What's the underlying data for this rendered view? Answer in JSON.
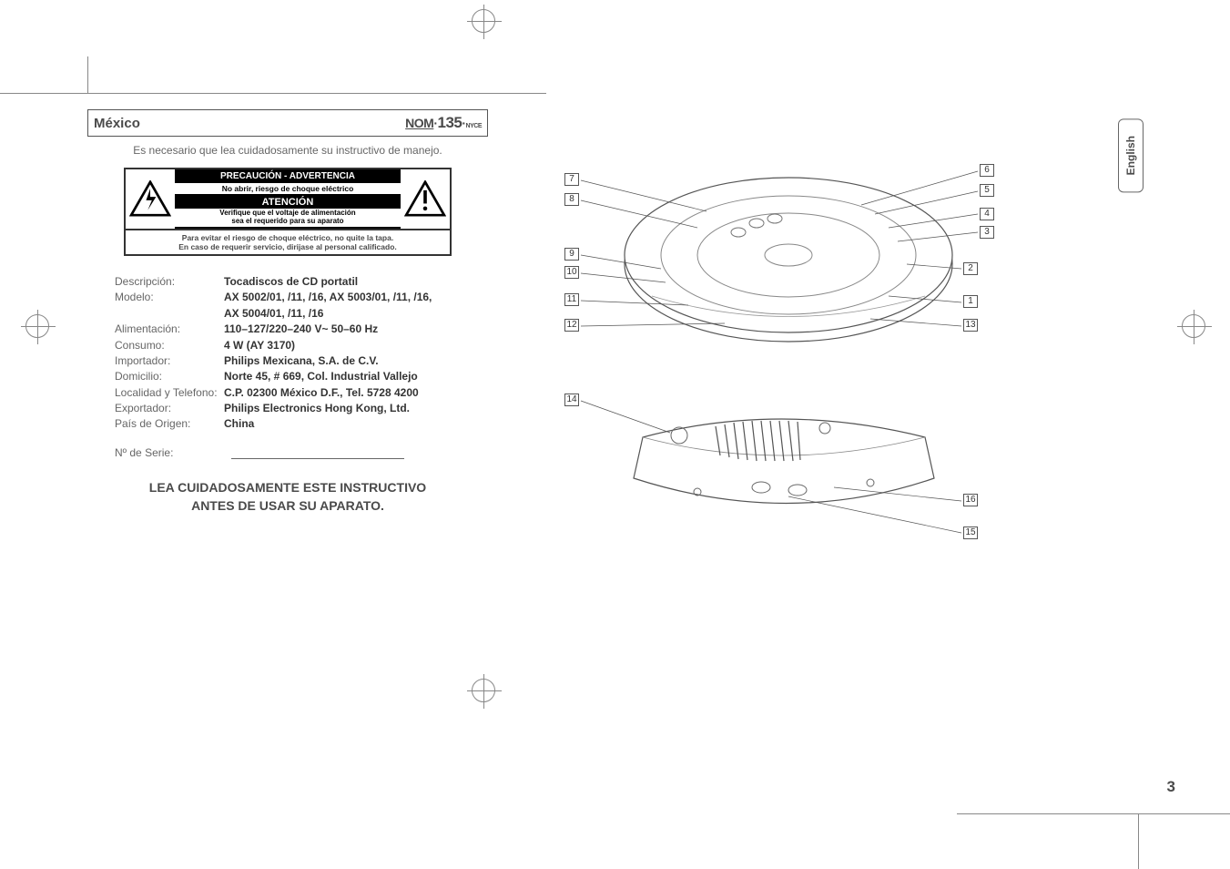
{
  "mexico_header": "México",
  "nom_mark": {
    "prefix": "NOM",
    "num": "135",
    "suffix": "NYCE"
  },
  "intro": "Es necesario que lea cuidadosamente su instructivo de manejo.",
  "warning": {
    "title": "PRECAUCIÓN - ADVERTENCIA",
    "sub": "No abrir, riesgo de choque eléctrico",
    "att": "ATENCIÓN",
    "verify_l1": "Verifique que el voltaje de alimentación",
    "verify_l2": "sea el requerido para su aparato",
    "bottom_l1": "Para evitar el riesgo de choque eléctrico, no quite la tapa.",
    "bottom_l2": "En caso de requerir servicio, dirijase al personal calificado."
  },
  "specs": [
    {
      "label": "Descripción:",
      "value": "Tocadiscos de CD portatil"
    },
    {
      "label": "Modelo:",
      "value": "AX 5002/01, /11, /16, AX 5003/01, /11, /16,"
    },
    {
      "label": "",
      "value": "AX 5004/01, /11, /16"
    },
    {
      "label": "Alimentación:",
      "value": "110–127/220–240 V~  50–60 Hz"
    },
    {
      "label": "Consumo:",
      "value": "4 W (AY 3170)"
    },
    {
      "label": "Importador:",
      "value": "Philips Mexicana, S.A. de C.V."
    },
    {
      "label": "Domicilio:",
      "value": "Norte 45, # 669, Col. Industrial Vallejo"
    },
    {
      "label": "Localidad y Telefono:",
      "value": "C.P. 02300 México D.F., Tel. 5728 4200"
    },
    {
      "label": "Exportador:",
      "value": "Philips Electronics Hong Kong, Ltd."
    },
    {
      "label": "País de Origen:",
      "value": "China"
    }
  ],
  "serie_label": "Nº de Serie:",
  "closing_l1": "LEA CUIDADOSAMENTE ESTE INSTRUCTIVO",
  "closing_l2": "ANTES DE USAR SU APARATO.",
  "lang_tab": "English",
  "page_number": "3",
  "callouts_top": {
    "left": [
      "7",
      "8",
      "9",
      "10",
      "11",
      "12"
    ],
    "right": [
      "6",
      "5",
      "4",
      "3",
      "2",
      "1",
      "13"
    ]
  },
  "callouts_bottom": {
    "left": [
      "14"
    ],
    "right": [
      "16",
      "15"
    ]
  }
}
